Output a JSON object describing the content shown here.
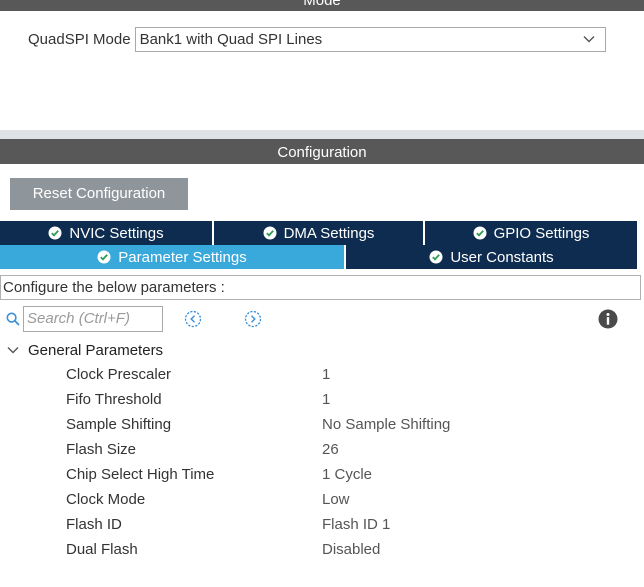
{
  "mode_section": {
    "title": "Mode",
    "quadspi_label": "QuadSPI Mode",
    "quadspi_value": "Bank1 with Quad SPI Lines"
  },
  "configuration": {
    "title": "Configuration",
    "reset_label": "Reset Configuration"
  },
  "tabs": {
    "nvic": "NVIC Settings",
    "dma": "DMA Settings",
    "gpio": "GPIO Settings",
    "parameter": "Parameter Settings",
    "user_constants": "User Constants"
  },
  "info_text": "Configure the below parameters :",
  "search": {
    "placeholder": "Search (Ctrl+F)"
  },
  "group": {
    "title": "General Parameters",
    "params": [
      {
        "name": "Clock Prescaler",
        "value": "1"
      },
      {
        "name": "Fifo Threshold",
        "value": "1"
      },
      {
        "name": "Sample Shifting",
        "value": "No Sample Shifting"
      },
      {
        "name": "Flash Size",
        "value": "26"
      },
      {
        "name": "Chip Select High Time",
        "value": "1 Cycle"
      },
      {
        "name": "Clock Mode",
        "value": "Low"
      },
      {
        "name": "Flash ID",
        "value": "Flash ID 1"
      },
      {
        "name": "Dual Flash",
        "value": "Disabled"
      }
    ]
  },
  "colors": {
    "header_bar": "#585858",
    "tab_dark": "#0d2c4f",
    "tab_active": "#39a9dc",
    "reset_button": "#8f969b"
  },
  "icons": [
    "chevron-down-icon",
    "check-circle-icon",
    "search-icon",
    "previous-icon",
    "next-icon",
    "info-icon",
    "collapse-chevron-icon"
  ]
}
